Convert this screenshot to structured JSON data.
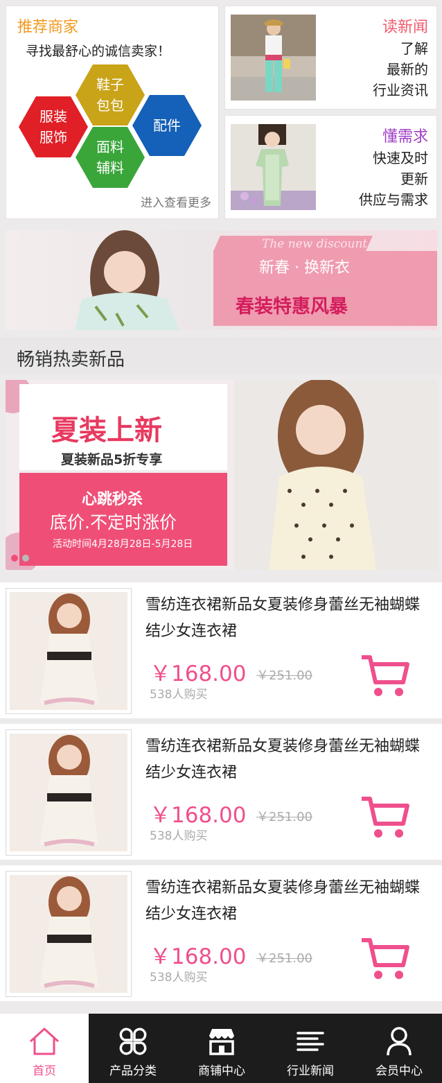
{
  "merchants": {
    "title": "推荐商家",
    "subtitle": "寻找最舒心的诚信卖家！",
    "more": "进入查看更多",
    "hexes": [
      {
        "line1": "鞋子",
        "line2": "包包",
        "color": "#c9a318"
      },
      {
        "line1": "服装",
        "line2": "服饰",
        "color": "#e01f26"
      },
      {
        "line1": "配件",
        "line2": "",
        "color": "#1560b8"
      },
      {
        "line1": "面料",
        "line2": "辅料",
        "color": "#3aa63a"
      }
    ]
  },
  "news": {
    "title": "读新闻",
    "title_color": "#ef5a6e",
    "lines": [
      "了解",
      "最新的",
      "行业资讯"
    ]
  },
  "demand": {
    "title": "懂需求",
    "title_color": "#a03ec6",
    "lines": [
      "快速及时",
      "更新",
      "供应与需求"
    ]
  },
  "banner_spring": {
    "script": "The new discount",
    "tagline": "新春 · 换新衣",
    "headline": "春装特惠风暴"
  },
  "section": {
    "title": "畅销热卖新品"
  },
  "banner_summer": {
    "headline": "夏装上新",
    "subline": "夏装新品5折专享",
    "flash": "心跳秒杀",
    "flash_sub": "底价.不定时涨价",
    "period": "活动时间4月28月28日-5月28日"
  },
  "products": [
    {
      "title": "雪纺连衣裙新品女夏装修身蕾丝无袖蝴蝶结少女连衣裙",
      "price": "￥168.00",
      "old_price": "￥251.00",
      "sold": "538人购买"
    },
    {
      "title": "雪纺连衣裙新品女夏装修身蕾丝无袖蝴蝶结少女连衣裙",
      "price": "￥168.00",
      "old_price": "￥251.00",
      "sold": "538人购买"
    },
    {
      "title": "雪纺连衣裙新品女夏装修身蕾丝无袖蝴蝶结少女连衣裙",
      "price": "￥168.00",
      "old_price": "￥251.00",
      "sold": "538人购买"
    }
  ],
  "nav": [
    {
      "label": "首页",
      "icon": "home-icon",
      "active": true
    },
    {
      "label": "产品分类",
      "icon": "category-icon",
      "active": false
    },
    {
      "label": "商铺中心",
      "icon": "store-icon",
      "active": false
    },
    {
      "label": "行业新闻",
      "icon": "news-icon",
      "active": false
    },
    {
      "label": "会员中心",
      "icon": "user-icon",
      "active": false
    }
  ],
  "colors": {
    "accent": "#ef4f8c",
    "orange": "#f29a1e",
    "nav_bg": "#1c1c1c"
  }
}
